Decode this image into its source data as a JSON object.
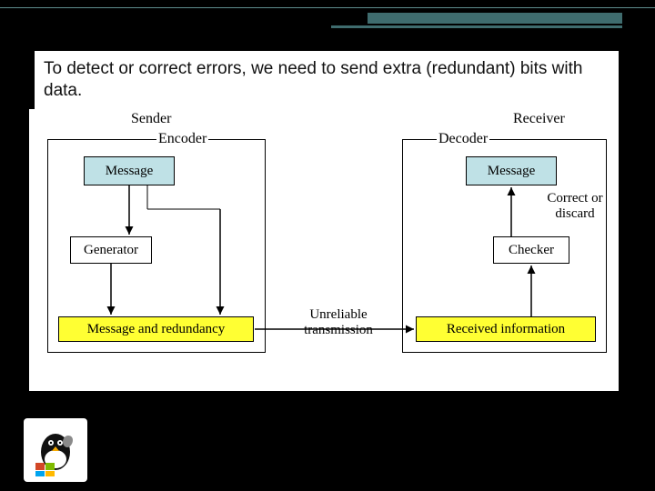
{
  "intro_text": "To detect or correct errors, we need to send extra (redundant) bits with data.",
  "diagram": {
    "sender_label": "Sender",
    "receiver_label": "Receiver",
    "encoder_label": "Encoder",
    "decoder_label": "Decoder",
    "message_label": "Message",
    "generator_label": "Generator",
    "checker_label": "Checker",
    "msg_redundancy_label": "Message and redundancy",
    "received_info_label": "Received information",
    "channel_label": "Unreliable transmission",
    "correct_discard_label": "Correct or\ndiscard"
  }
}
